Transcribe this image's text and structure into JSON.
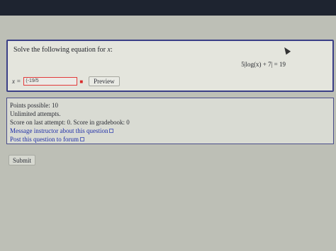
{
  "question": {
    "prompt_text": "Solve the following equation for",
    "prompt_var": "x",
    "prompt_colon": ":",
    "equation": "5|log(x) + 7| = 19",
    "answer_label": "x =",
    "answer_value": "(-19/5",
    "preview_label": "Preview"
  },
  "info": {
    "points": "Points possible: 10",
    "attempts": "Unlimited attempts.",
    "score": "Score on last attempt: 0. Score in gradebook: 0",
    "message_link": "Message instructor about this question",
    "forum_link": "Post this question to forum"
  },
  "actions": {
    "submit_label": "Submit"
  }
}
